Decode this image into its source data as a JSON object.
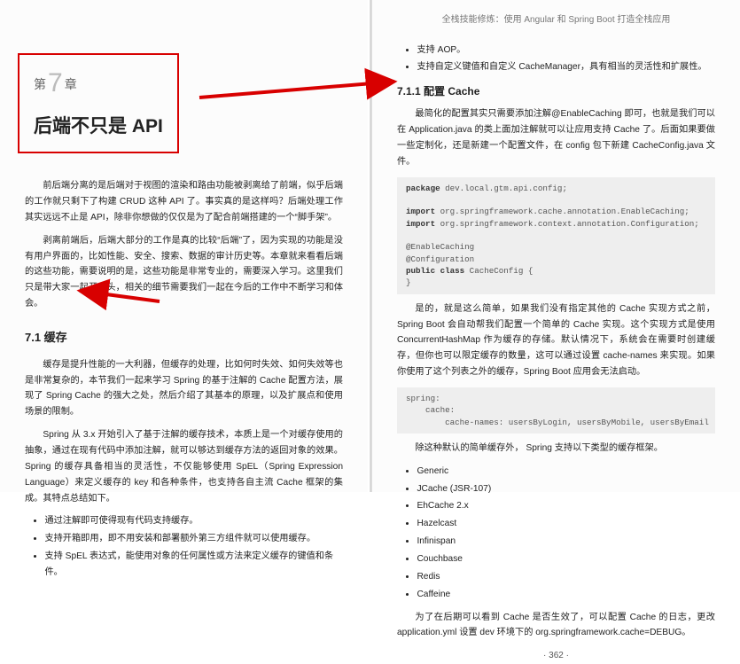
{
  "running_head": "全栈技能修炼：使用 Angular 和 Spring Boot 打造全栈应用",
  "page_number": "· 362 ·",
  "left": {
    "chapter_eyebrow_pre": "第",
    "chapter_num": "7",
    "chapter_eyebrow_post": "章",
    "chapter_title": "后端不只是 API",
    "p1": "前后端分离的是后端对于视图的渲染和路由功能被剥离给了前端，似乎后端的工作就只剩下了构建 CRUD 这种 API 了。事实真的是这样吗？后端处理工作其实远远不止是 API，除非你想做的仅仅是为了配合前端搭建的一个“脚手架”。",
    "p2": "剥离前端后，后端大部分的工作是真的比较“后端”了，因为实现的功能是没有用户界面的，比如性能、安全、搜索、数据的审计历史等。本章就来看看后端的这些功能，需要说明的是，这些功能是非常专业的，需要深入学习。这里我们只是带大家一起开个头，相关的细节需要我们一起在今后的工作中不断学习和体会。",
    "sec_7_1": "7.1  缓存",
    "p3": "缓存是提升性能的一大利器，但缓存的处理，比如何时失效、如何失效等也是非常复杂的，本节我们一起来学习 Spring 的基于注解的 Cache 配置方法，展现了 Spring Cache 的强大之处，然后介绍了其基本的原理，以及扩展点和使用场景的限制。",
    "p4": "Spring 从 3.x 开始引入了基于注解的缓存技术，本质上是一个对缓存使用的抽象，通过在现有代码中添加注解，就可以够达到缓存方法的返回对象的效果。Spring 的缓存具备相当的灵活性，不仅能够使用 SpEL（Spring Expression Language）来定义缓存的 key 和各种条件，也支持各自主流 Cache 框架的集成。其特点总结如下。",
    "li1": "通过注解即可使得现有代码支持缓存。",
    "li2": "支持开箱即用，即不用安装和部署额外第三方组件就可以使用缓存。",
    "li3": "支持 SpEL 表达式，能使用对象的任何属性或方法来定义缓存的键值和条件。"
  },
  "right": {
    "bullets_top1": "支持 AOP。",
    "bullets_top2": "支持自定义键值和自定义 CacheManager，具有相当的灵活性和扩展性。",
    "sec_7_1_1": "7.1.1  配置 Cache",
    "p1": "最简化的配置其实只需要添加注解@EnableCaching 即可，也就是我们可以在 Application.java 的类上面加注解就可以让应用支持 Cache 了。后面如果要做一些定制化，还是新建一个配置文件，在 config 包下新建 CacheConfig.java 文件。",
    "code1": "package dev.local.gtm.api.config;\n\nimport org.springframework.cache.annotation.EnableCaching;\nimport org.springframework.context.annotation.Configuration;\n\n@EnableCaching\n@Configuration\npublic class CacheConfig {\n}",
    "p2": "是的，就是这么简单，如果我们没有指定其他的 Cache 实现方式之前，Spring Boot 会自动帮我们配置一个简单的 Cache 实现。这个实现方式是使用 ConcurrentHashMap 作为缓存的存储。默认情况下，系统会在需要时创建缓存，但你也可以限定缓存的数量，这可以通过设置 cache-names 来实现。如果你使用了这个列表之外的缓存，Spring Boot 应用会无法启动。",
    "code2": "spring:\n    cache:\n        cache-names: usersByLogin, usersByMobile, usersByEmail",
    "p3": "除这种默认的简单缓存外， Spring 支持以下类型的缓存框架。",
    "libs": [
      "Generic",
      "JCache (JSR-107)",
      "EhCache 2.x",
      "Hazelcast",
      "Infinispan",
      "Couchbase",
      "Redis",
      "Caffeine"
    ],
    "p4": "为了在后期可以看到 Cache 是否生效了，可以配置 Cache 的日志，更改 application.yml 设置 dev 环境下的 org.springframework.cache=DEBUG。"
  }
}
